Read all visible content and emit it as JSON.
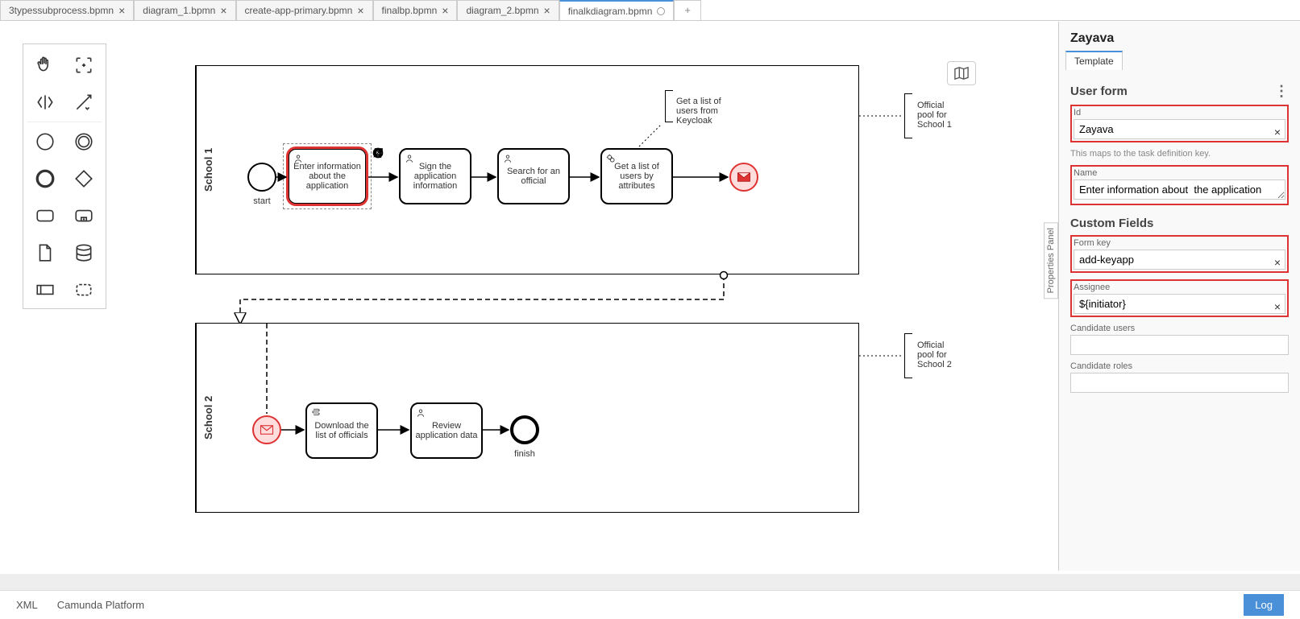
{
  "tabs": [
    {
      "label": "3typessubprocess.bpmn",
      "active": false
    },
    {
      "label": "diagram_1.bpmn",
      "active": false
    },
    {
      "label": "create-app-primary.bpmn",
      "active": false
    },
    {
      "label": "finalbp.bpmn",
      "active": false
    },
    {
      "label": "diagram_2.bpmn",
      "active": false
    },
    {
      "label": "finalkdiagram.bpmn",
      "active": true,
      "modified": true
    }
  ],
  "pool1": {
    "label": "School 1",
    "annotation_right": "Official pool for School 1",
    "start_label": "start",
    "task1": "Enter information about the application",
    "task2": "Sign the application information",
    "task3": "Search for an official",
    "task4": "Get a list of users by attributes",
    "annotation_top": "Get a list of users from Keycloak"
  },
  "pool2": {
    "label": "School 2",
    "annotation_right": "Official pool for School 2",
    "task1": "Download the list of officials",
    "task2": "Review application data",
    "end_label": "finish"
  },
  "properties": {
    "title": "Zayava",
    "tab": "Template",
    "section1": "User form",
    "id_label": "Id",
    "id_value": "Zayava",
    "id_help": "This maps to the task definition key.",
    "name_label": "Name",
    "name_value": "Enter information about  the application",
    "section2": "Custom Fields",
    "formkey_label": "Form key",
    "formkey_value": "add-keyapp",
    "assignee_label": "Assignee",
    "assignee_value": "${initiator}",
    "candusers_label": "Candidate users",
    "candusers_value": "",
    "candroles_label": "Candidate roles",
    "candroles_value": ""
  },
  "panel_toggle": "Properties Panel",
  "footer": {
    "xml": "XML",
    "platform": "Camunda Platform",
    "log": "Log"
  }
}
